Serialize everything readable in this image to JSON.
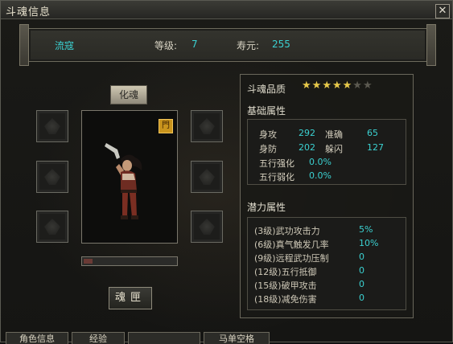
{
  "window": {
    "title": "斗魂信息",
    "close_glyph": "✕"
  },
  "info": {
    "name": "流寇",
    "level_label": "等级:",
    "level_value": "7",
    "life_label": "寿元:",
    "life_value": "255"
  },
  "left": {
    "huahun_button": "化魂",
    "door_badge": "門",
    "progress_fraction": 0.1,
    "hunxia_button": "魂匣"
  },
  "right": {
    "quality_label": "斗魂品质",
    "stars_filled": 5,
    "stars_total": 7,
    "basic_title": "基础属性",
    "basic": {
      "attack_label": "身攻",
      "attack_value": "292",
      "accuracy_label": "准确",
      "accuracy_value": "65",
      "defense_label": "身防",
      "defense_value": "202",
      "dodge_label": "躲闪",
      "dodge_value": "127",
      "wuxing_strong_label": "五行强化",
      "wuxing_strong_value": "0.0%",
      "wuxing_weak_label": "五行弱化",
      "wuxing_weak_value": "0.0%"
    },
    "potential_title": "潜力属性",
    "potential": [
      {
        "label": "(3级)武功攻击力",
        "value": "5%"
      },
      {
        "label": "(6级)真气触发几率",
        "value": "10%"
      },
      {
        "label": "(9级)远程武功压制",
        "value": "0"
      },
      {
        "label": "(12级)五行抵御",
        "value": "0"
      },
      {
        "label": "(15级)破甲攻击",
        "value": "0"
      },
      {
        "label": "(18级)减免伤害",
        "value": "0"
      }
    ]
  },
  "tabs": [
    "角色信息",
    "经验",
    "",
    "马单空格"
  ],
  "colors": {
    "accent_cyan": "#3bd1d1",
    "star_gold": "#e7c94a",
    "badge_orange": "#c9941d"
  }
}
